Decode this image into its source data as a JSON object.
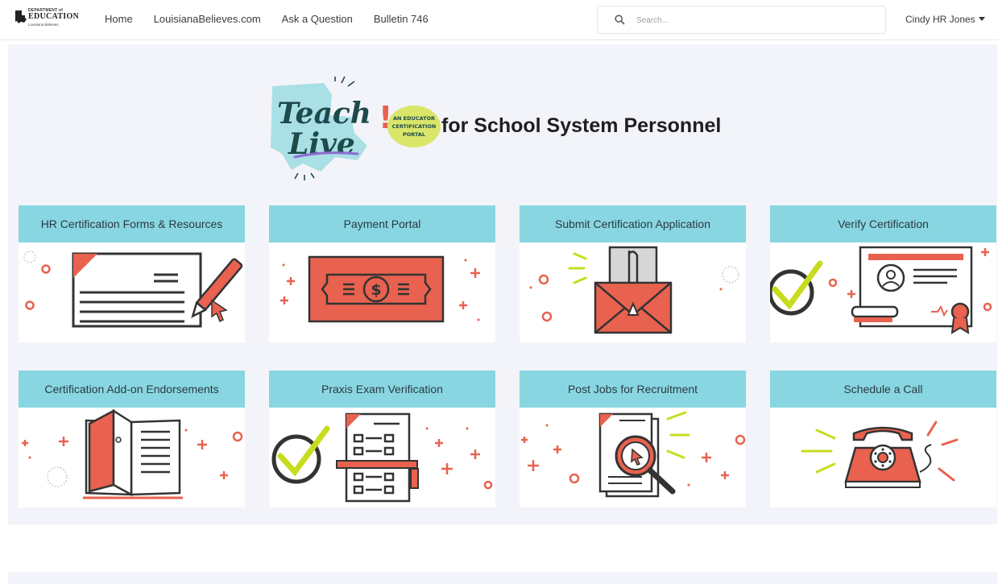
{
  "header": {
    "logo": {
      "line1": "DEPARTMENT of",
      "line2": "EDUCATION",
      "line3": "Louisiana Believes"
    },
    "nav": [
      {
        "label": "Home"
      },
      {
        "label": "LouisianaBelieves.com"
      },
      {
        "label": "Ask a Question"
      },
      {
        "label": "Bulletin 746"
      }
    ],
    "search": {
      "placeholder": "Search..."
    },
    "user": {
      "name": "Cindy HR Jones"
    }
  },
  "hero": {
    "logo_words": [
      "Teach",
      "Live",
      "!"
    ],
    "logo_badge": [
      "AN EDUCATOR",
      "CERTIFICATION",
      "PORTAL"
    ],
    "title": "for School System Personnel"
  },
  "tiles": [
    {
      "label": "HR Certification Forms & Resources",
      "icon": "form-pen-icon"
    },
    {
      "label": "Payment Portal",
      "icon": "dollar-bill-icon"
    },
    {
      "label": "Submit Certification Application",
      "icon": "envelope-clip-icon"
    },
    {
      "label": "Verify Certification",
      "icon": "certificate-check-icon"
    },
    {
      "label": "Certification Add-on Endorsements",
      "icon": "open-book-icon"
    },
    {
      "label": "Praxis Exam Verification",
      "icon": "exam-check-icon"
    },
    {
      "label": "Post Jobs for Recruitment",
      "icon": "magnifier-document-icon"
    },
    {
      "label": "Schedule a Call",
      "icon": "telephone-icon"
    }
  ],
  "colors": {
    "tile_header": "#88d6e1",
    "accent_red": "#e8624f",
    "accent_lime": "#c8dc1e",
    "hero_bg": "#f3f4f9",
    "logo_teal": "#a9e0e6",
    "logo_text": "#1d4a4a"
  }
}
